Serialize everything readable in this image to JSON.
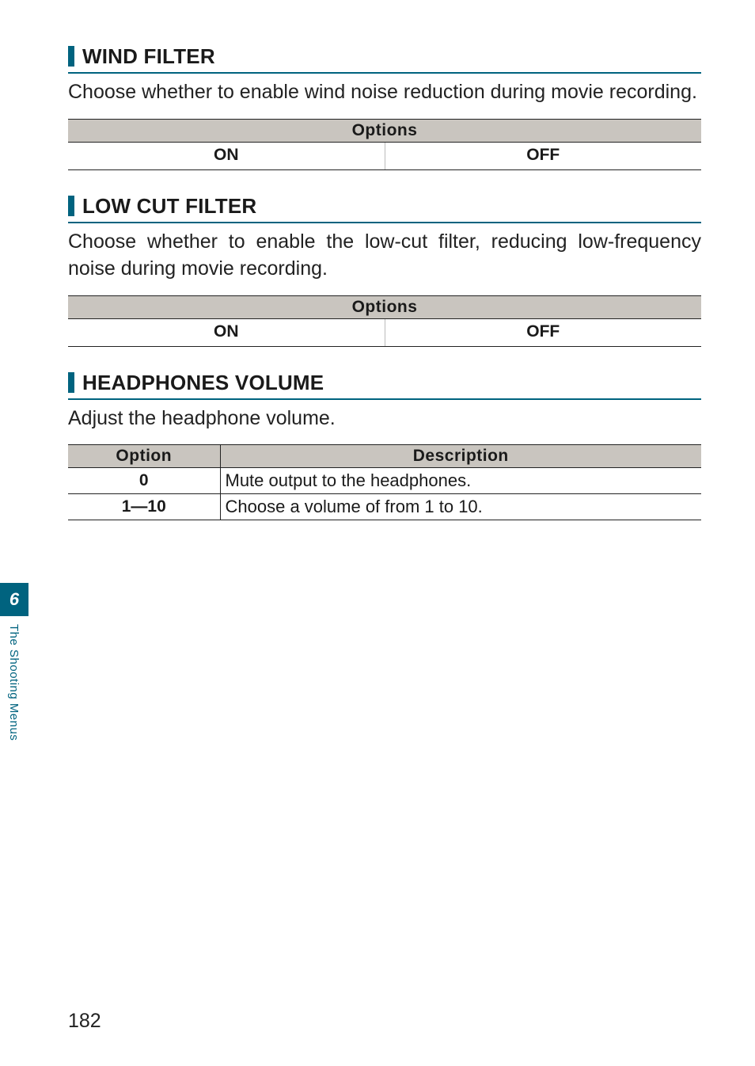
{
  "sections": [
    {
      "heading": "WIND FILTER",
      "body": "Choose whether to enable wind noise reduction during movie recording.",
      "options_header": "Options",
      "options": [
        "ON",
        "OFF"
      ]
    },
    {
      "heading": "LOW CUT FILTER",
      "body": "Choose whether to enable the low-cut filter, reducing low-frequency noise during movie recording.",
      "options_header": "Options",
      "options": [
        "ON",
        "OFF"
      ]
    },
    {
      "heading": "HEADPHONES VOLUME",
      "body": "Adjust the headphone volume.",
      "table_headers": [
        "Option",
        "Description"
      ],
      "rows": [
        {
          "option": "0",
          "description": "Mute output to the headphones."
        },
        {
          "option": "1—10",
          "description": "Choose a volume of from 1 to 10."
        }
      ]
    }
  ],
  "side_tab_number": "6",
  "side_label": "The Shooting Menus",
  "page_number": "182"
}
